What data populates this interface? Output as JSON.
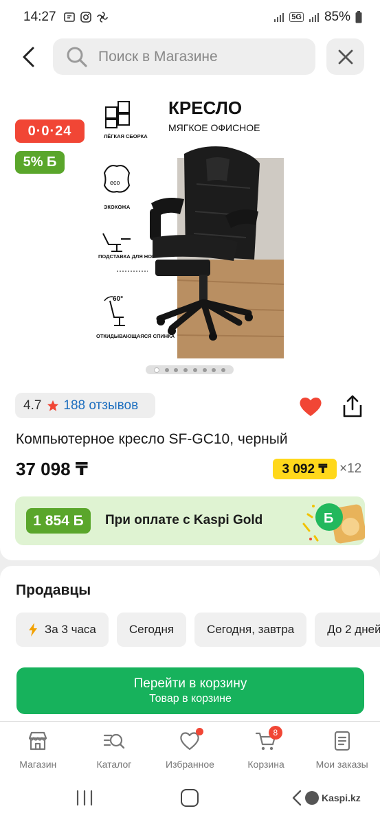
{
  "status_bar": {
    "time": "14:27",
    "network": "5G",
    "battery": "85%"
  },
  "header": {
    "search_placeholder": "Поиск в Магазине"
  },
  "product": {
    "timer_badge": "0·0·24",
    "bonus_badge": "5% Б",
    "image_text": {
      "headline": "КРЕСЛО",
      "subheadline": "МЯГКОЕ ОФИСНОЕ",
      "feature_1": "ЛЁГКАЯ СБОРКА",
      "feature_2": "ЭКОКОЖА",
      "feature_3": "ПОДСТАВКА ДЛЯ НОГ",
      "feature_4": "ОТКИДЫВАЮЩАЯСЯ СПИНКА",
      "eco_label": "eco",
      "angle_label": "60°"
    },
    "gallery_count": 8,
    "gallery_active": 1,
    "rating": "4.7",
    "reviews": "188 отзывов",
    "title": "Компьютерное кресло SF-GC10, черный",
    "price": "37 098 ₸",
    "installment": "3 092 ₸",
    "installment_months": "×12",
    "kaspi_gold": {
      "amount": "1 854 Б",
      "text": "При оплате с Kaspi Gold"
    }
  },
  "sellers": {
    "title": "Продавцы",
    "filters": [
      "За 3 часа",
      "Сегодня",
      "Сегодня, завтра",
      "До 2 дней"
    ],
    "cart_button": {
      "label": "Перейти в корзину",
      "sublabel": "Товар в корзине"
    }
  },
  "bottom_nav": {
    "items": [
      {
        "label": "Магазин",
        "icon": "store-icon"
      },
      {
        "label": "Каталог",
        "icon": "catalog-icon"
      },
      {
        "label": "Избранное",
        "icon": "heart-icon"
      },
      {
        "label": "Корзина",
        "icon": "cart-icon",
        "badge": "8"
      },
      {
        "label": "Мои заказы",
        "icon": "orders-icon"
      }
    ]
  },
  "watermark": "Kaspi.kz",
  "colors": {
    "accent_red": "#f14635",
    "bonus_green": "#5aa62b",
    "cta_green": "#17b25c",
    "installment_yellow": "#ffd81b",
    "link_blue": "#1e6fbf"
  }
}
